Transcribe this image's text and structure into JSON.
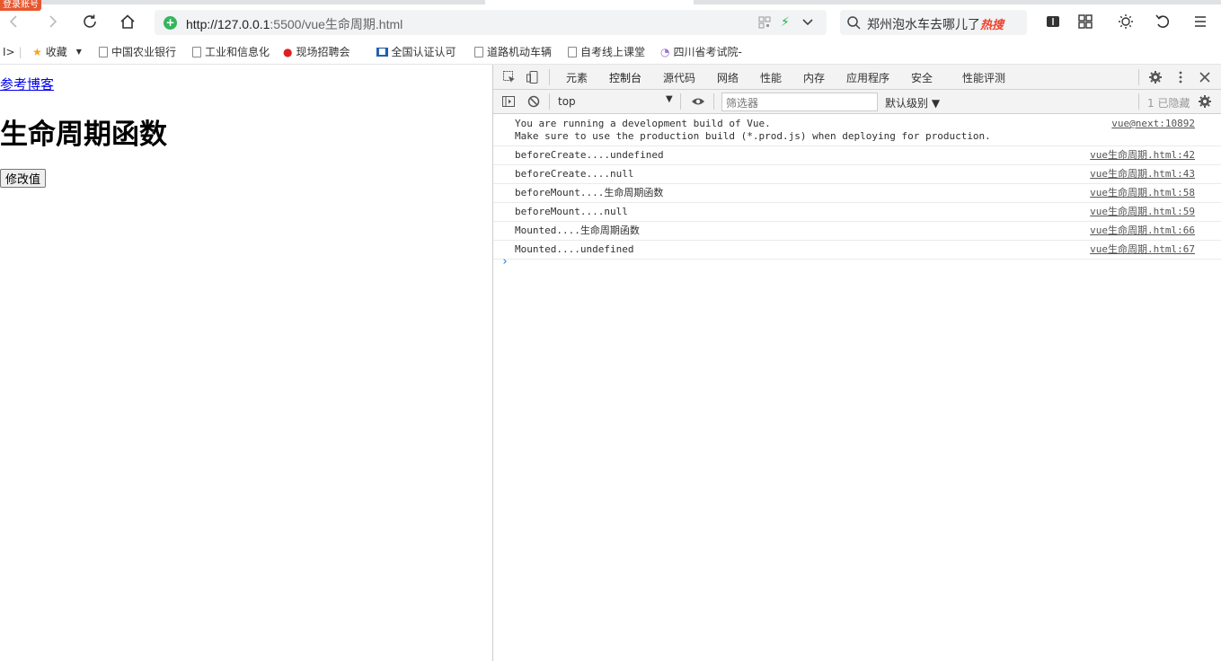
{
  "browser": {
    "login_badge": "登录账号",
    "url_host": "http://127.0.0.1",
    "url_rest": ":5500/vue生命周期.html",
    "search_text": "郑州泡水车去哪儿了",
    "search_hot": "热搜"
  },
  "bookmarks": [
    {
      "label": "收藏"
    },
    {
      "label": "中国农业银行"
    },
    {
      "label": "工业和信息化"
    },
    {
      "label": "现场招聘会"
    },
    {
      "label": "全国认证认可"
    },
    {
      "label": "道路机动车辆"
    },
    {
      "label": "自考线上课堂"
    },
    {
      "label": "四川省考试院-"
    }
  ],
  "page": {
    "link": "参考博客",
    "heading": "生命周期函数",
    "button": "修改值"
  },
  "devtools": {
    "tabs": [
      "元素",
      "控制台",
      "源代码",
      "网络",
      "性能",
      "内存",
      "应用程序",
      "安全",
      "性能评测"
    ],
    "active_tab": "控制台",
    "context": "top",
    "filter_placeholder": "筛选器",
    "levels": "默认级别 ▼",
    "hidden": "1 已隐藏",
    "logs": [
      {
        "msg": "You are running a development build of Vue.\nMake sure to use the production build (*.prod.js) when deploying for production.",
        "src": "vue@next:10892"
      },
      {
        "msg": "beforeCreate....undefined",
        "src": "vue生命周期.html:42"
      },
      {
        "msg": "beforeCreate....null",
        "src": "vue生命周期.html:43"
      },
      {
        "msg": "beforeMount....生命周期函数",
        "src": "vue生命周期.html:58"
      },
      {
        "msg": "beforeMount....null",
        "src": "vue生命周期.html:59"
      },
      {
        "msg": "Mounted....生命周期函数",
        "src": "vue生命周期.html:66"
      },
      {
        "msg": "Mounted....undefined",
        "src": "vue生命周期.html:67"
      }
    ],
    "prompt": "›"
  }
}
